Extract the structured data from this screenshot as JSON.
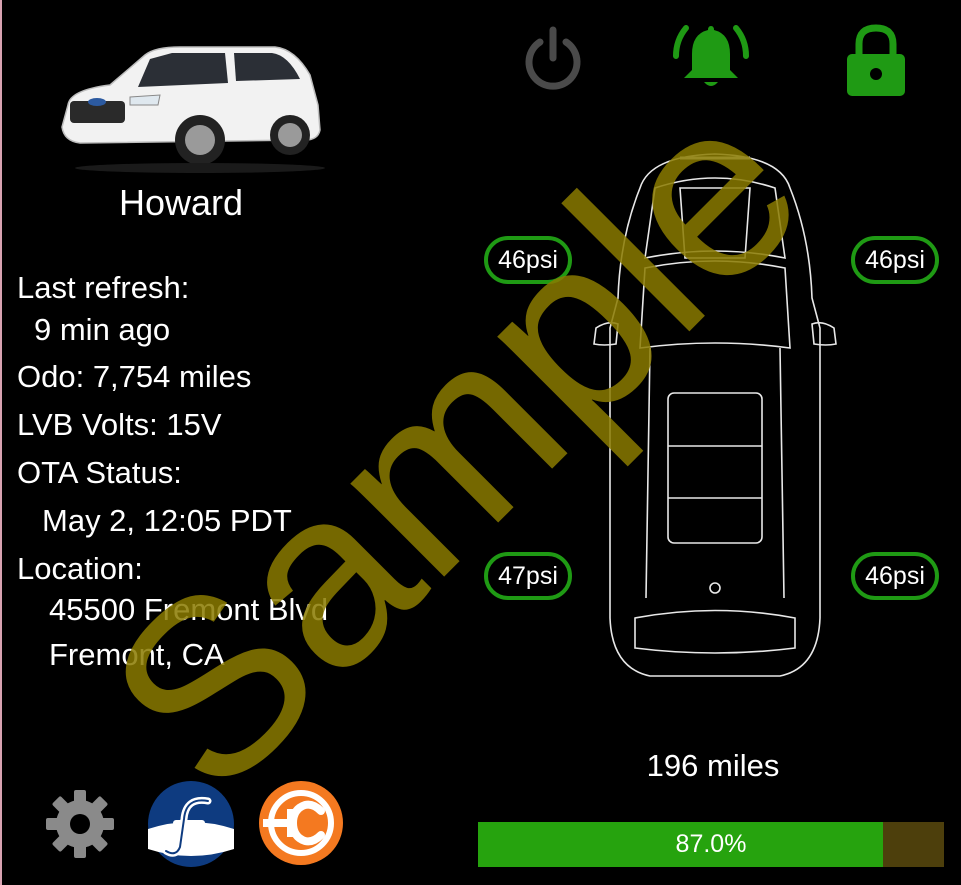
{
  "vehicle": {
    "name": "Howard",
    "photo_icon": "suv-photo"
  },
  "info": {
    "last_refresh_label": "Last refresh:",
    "last_refresh_value": "9 min ago",
    "odometer": "Odo: 7,754 miles",
    "lvb_volts": "LVB Volts: 15V",
    "ota_label": "OTA Status:",
    "ota_value": "May 2, 12:05 PDT",
    "location_label": "Location:",
    "location_line1": "45500 Fremont Blvd",
    "location_line2": "Fremont, CA"
  },
  "status_icons": {
    "power": {
      "icon": "power-icon",
      "color": "#4a4a4a"
    },
    "alarm": {
      "icon": "bell-icon",
      "color": "#1f9a14"
    },
    "lock": {
      "icon": "lock-icon",
      "color": "#1f9a14"
    }
  },
  "tires": {
    "front_left": "46psi",
    "front_right": "46psi",
    "rear_left": "47psi",
    "rear_right": "46psi",
    "ring_color": "#1f9a14"
  },
  "range": {
    "miles": "196 miles",
    "charge_percent": 87.0,
    "charge_label": "87.0%",
    "fill_color": "#26a30e",
    "empty_color": "#4d3f0c"
  },
  "bottom_icons": [
    "gear-icon",
    "ford-logo-icon",
    "charging-app-icon"
  ],
  "watermark": {
    "text": "Sample",
    "color": "#8a7a00"
  }
}
